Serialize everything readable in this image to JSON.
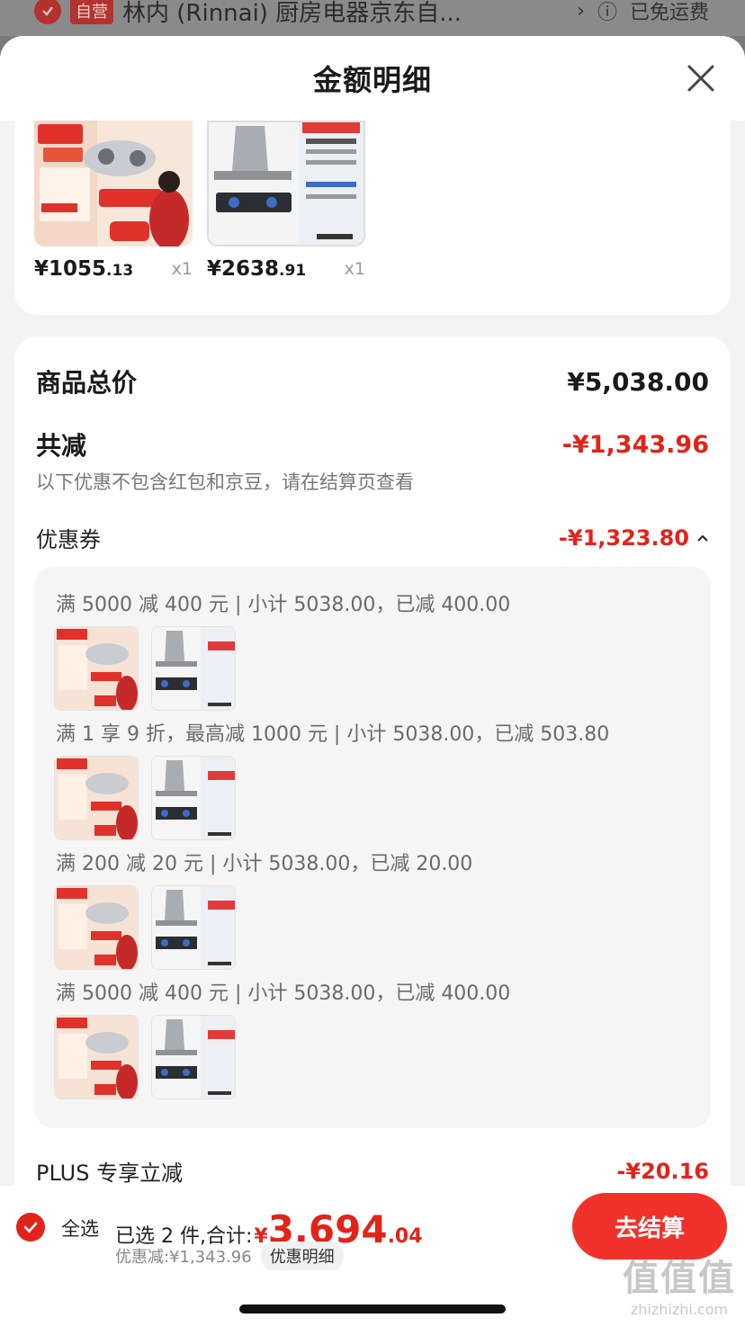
{
  "background": {
    "store_tag": "自营",
    "store_title": "林内 (Rinnai) 厨房电器京东自...",
    "shipping": "已免运费"
  },
  "sheet": {
    "title": "金额明细"
  },
  "products": [
    {
      "price_int": "¥1055",
      "price_dec": ".13",
      "qty": "x1",
      "thumb": "rinnai-stove-promo"
    },
    {
      "price_int": "¥2638",
      "price_dec": ".91",
      "qty": "x1",
      "thumb": "robam-hood-set"
    }
  ],
  "detail": {
    "total_label": "商品总价",
    "total_value": "¥5,038.00",
    "reduce_label": "共减",
    "reduce_value": "-¥1,343.96",
    "reduce_note": "以下优惠不包含红包和京豆，请在结算页查看",
    "coupon_label": "优惠券",
    "coupon_value": "-¥1,323.80",
    "coupon_items": [
      "满 5000 减 400 元 | 小计 5038.00，已减 400.00",
      "满 1 享 9 折，最高减 1000 元 | 小计 5038.00，已减 503.80",
      "满 200 减 20 元 | 小计 5038.00，已减 20.00",
      "满 5000 减 400 元 | 小计 5038.00，已减 400.00"
    ],
    "plus_label": "PLUS 专享立减",
    "plus_value": "-¥20.16"
  },
  "bottom": {
    "select_all": "全选",
    "selected_text": "已选 2 件,合计:",
    "total_yen": "¥",
    "total_int": "3,694",
    "total_dec": ".04",
    "discount_text": "优惠减:¥1,343.96",
    "discount_link": "优惠明细",
    "checkout": "去结算"
  },
  "watermark": {
    "big": "值值值",
    "small": "zhizhizhi.com"
  },
  "colors": {
    "accent_red": "#e2231a",
    "checkout_red": "#f0322a"
  }
}
